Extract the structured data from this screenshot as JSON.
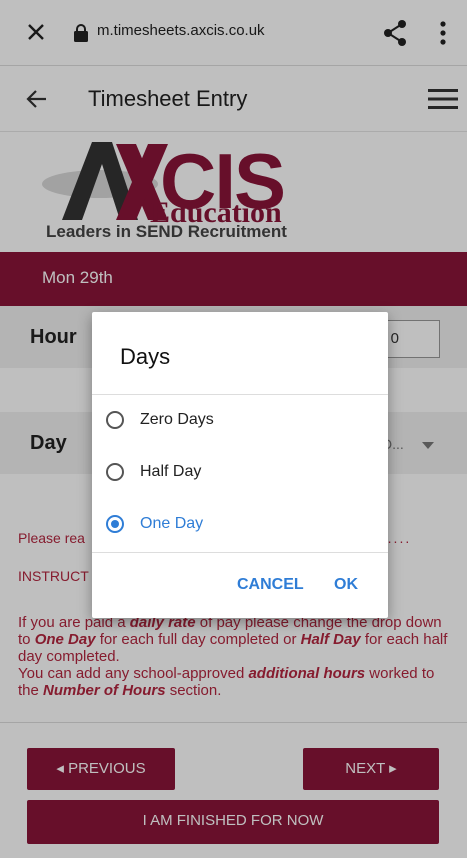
{
  "browser": {
    "url": "m.timesheets.axcis.co.uk",
    "icons": [
      "close-icon",
      "lock-icon",
      "share-icon",
      "more-vert-icon"
    ]
  },
  "appbar": {
    "title": "Timesheet Entry",
    "icons": [
      "arrow-back-icon",
      "hamburger-menu-icon"
    ]
  },
  "logo": {
    "cis": "CIS",
    "education": "Education",
    "tagline": "Leaders in SEND Recruitment"
  },
  "day_header": "Mon 29th",
  "form": {
    "hours_label": "Hour",
    "hours_value": "0",
    "days_label": "Day",
    "days_value": "D..."
  },
  "notice": {
    "prefix": "Please rea",
    "dots": ".......",
    "instructions": "INSTRUCT"
  },
  "paragraph": {
    "l1a": "If you are paid a ",
    "daily_rate": "daily rate",
    "l1b": " of pay please change the drop down to ",
    "one_day": "One Day",
    "l1c": " for each full day completed or ",
    "half_day": "Half Day",
    "l1d": " for each half day completed.",
    "l2a": "You can add any school-approved ",
    "additional_hours": "additional hours",
    "l2b": " worked to the ",
    "number_of_hours": "Number of Hours",
    "l2c": " section."
  },
  "buttons": {
    "previous": "◂ PREVIOUS",
    "next": "NEXT ▸",
    "finished": "I AM FINISHED FOR NOW"
  },
  "dialog": {
    "title": "Days",
    "options": [
      {
        "label": "Zero Days",
        "selected": false
      },
      {
        "label": "Half Day",
        "selected": false
      },
      {
        "label": "One Day",
        "selected": true
      }
    ],
    "cancel": "CANCEL",
    "ok": "OK",
    "accent_color": "#2f7dd6"
  },
  "colors": {
    "brand": "#8a1538",
    "notice_text": "#b3263f"
  }
}
